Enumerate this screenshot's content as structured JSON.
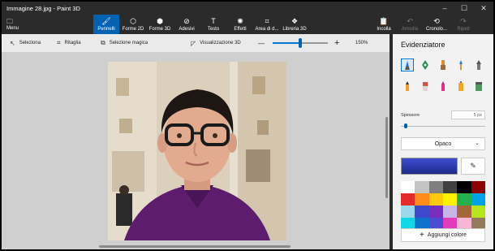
{
  "window": {
    "title": "Immagine 28.jpg - Paint 3D",
    "minimize_icon": "minimize-icon",
    "maximize_icon": "maximize-icon",
    "close_icon": "close-icon"
  },
  "menu": {
    "label": "Menu",
    "icon": "folder-icon"
  },
  "toolbar": {
    "tools": [
      {
        "label": "Pennelli",
        "icon": "brush-icon",
        "active": true
      },
      {
        "label": "Forme 2D",
        "icon": "shapes-2d-icon"
      },
      {
        "label": "Forme 3D",
        "icon": "cube-icon"
      },
      {
        "label": "Adesivi",
        "icon": "sticker-icon"
      },
      {
        "label": "Testo",
        "icon": "text-icon"
      },
      {
        "label": "Effetti",
        "icon": "effects-icon"
      },
      {
        "label": "Area di d...",
        "icon": "canvas-icon"
      },
      {
        "label": "Libreria 3D",
        "icon": "library-icon"
      }
    ],
    "actions": [
      {
        "label": "Incolla",
        "icon": "paste-icon",
        "enabled": true
      },
      {
        "label": "Annulla",
        "icon": "undo-icon",
        "enabled": false
      },
      {
        "label": "Cronolo...",
        "icon": "history-icon",
        "enabled": true
      },
      {
        "label": "Ripeti",
        "icon": "redo-icon",
        "enabled": false
      }
    ]
  },
  "subbar": {
    "select_label": "Seleziona",
    "crop_label": "Ritaglia",
    "magic_select_label": "Selezione magica",
    "view3d_label": "Visualizzazione 3D",
    "zoom_minus": "—",
    "zoom_plus": "+",
    "zoom_level": "150%",
    "zoom_fraction": 0.52
  },
  "panel": {
    "title": "Evidenziatore",
    "brushes": [
      "marker-icon",
      "calligraphy-pen-icon",
      "oil-brush-icon",
      "watercolor-icon",
      "pixel-pen-icon",
      "pencil-icon",
      "eraser-icon",
      "crayon-icon",
      "spray-can-icon",
      "fill-icon"
    ],
    "selected_brush": 0,
    "thickness_label": "Spessore",
    "thickness_value": "5 px",
    "thickness_fraction": 0.05,
    "opacity_label": "Opaco",
    "current_color": "#3d4fd1",
    "eyedropper_icon": "eyedropper-icon",
    "colors": [
      "#ffffff",
      "#c3c3c3",
      "#7f7f7f",
      "#404040",
      "#000000",
      "#8b0000",
      "#e32b2b",
      "#ff8c1a",
      "#ffc90e",
      "#fff200",
      "#22b14c",
      "#00a2e8",
      "#99d9ea",
      "#3f48cc",
      "#7b2dbe",
      "#c8b4e6",
      "#a4673b",
      "#b5e61d",
      "#12d7e6",
      "#0e72cc",
      "#4b4bd4",
      "#e43bb8",
      "#f7b6d2",
      "#937a5a"
    ],
    "add_colors_label": "Aggiungi colore"
  }
}
